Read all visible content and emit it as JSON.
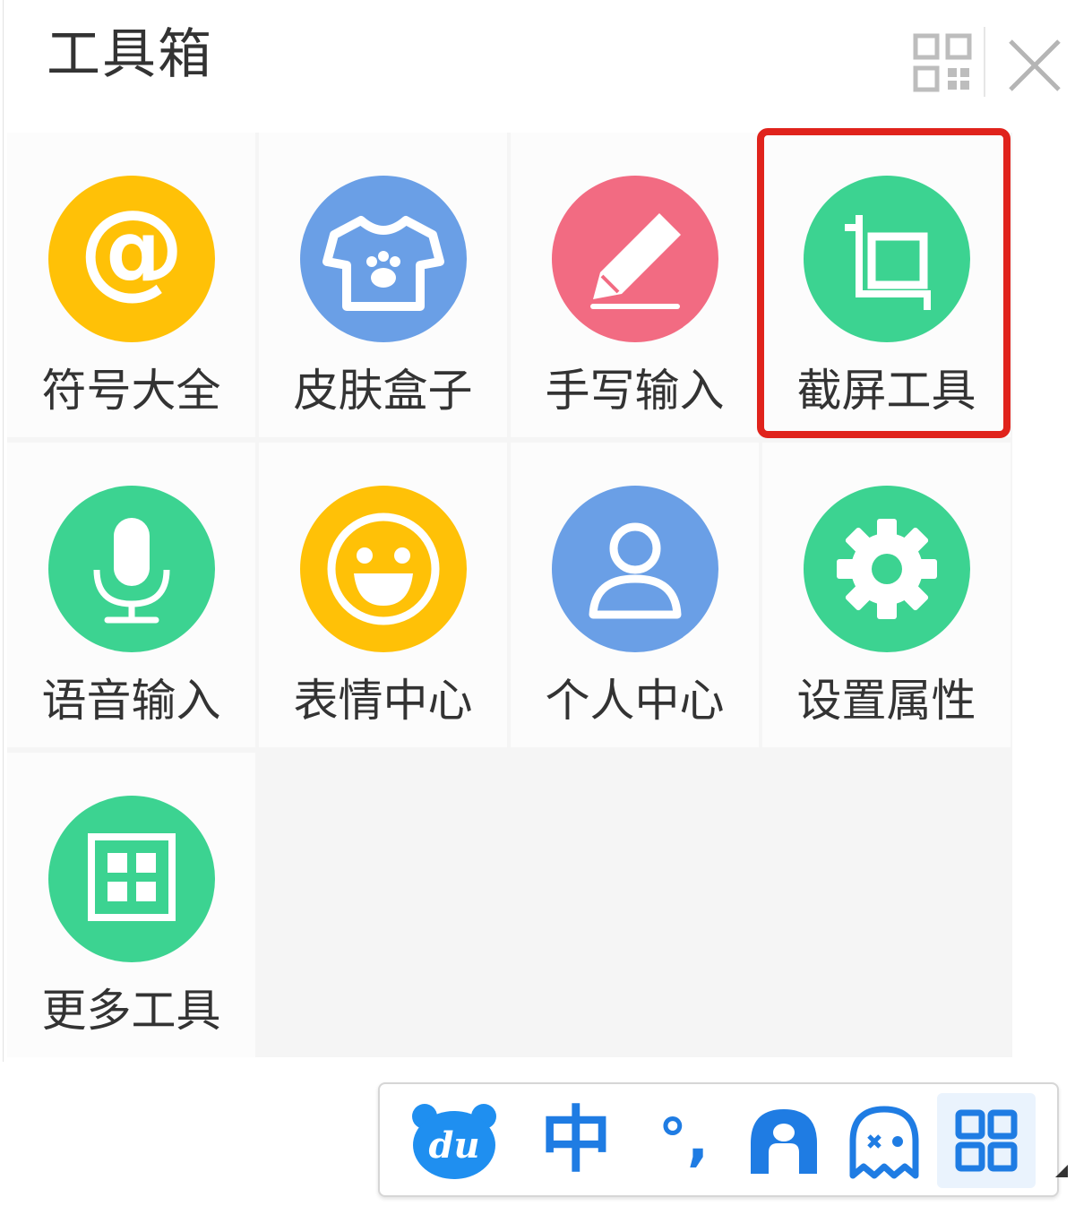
{
  "header": {
    "title": "工具箱",
    "layout_icon": "grid-layout-icon",
    "close_icon": "close-icon"
  },
  "tools": [
    {
      "label": "符号大全",
      "icon": "at-sign-icon",
      "color": "#ffc107"
    },
    {
      "label": "皮肤盒子",
      "icon": "t-shirt-paw-icon",
      "color": "#6a9fe6"
    },
    {
      "label": "手写输入",
      "icon": "pencil-icon",
      "color": "#f26b82"
    },
    {
      "label": "截屏工具",
      "icon": "crop-icon",
      "color": "#3cd391",
      "highlighted": true
    },
    {
      "label": "语音输入",
      "icon": "microphone-icon",
      "color": "#3cd391"
    },
    {
      "label": "表情中心",
      "icon": "smiley-face-icon",
      "color": "#ffc107"
    },
    {
      "label": "个人中心",
      "icon": "user-icon",
      "color": "#6a9fe6"
    },
    {
      "label": "设置属性",
      "icon": "gear-icon",
      "color": "#3cd391"
    },
    {
      "label": "更多工具",
      "icon": "more-grid-icon",
      "color": "#3cd391"
    }
  ],
  "ime_bar": {
    "logo_icon": "baidu-du-logo-icon",
    "logo_text": "du",
    "lang_label": "中",
    "punct_label": "°,",
    "items": [
      "skin-icon",
      "emoji-ghost-icon",
      "toolbox-grid-icon"
    ]
  },
  "colors": {
    "accent_blue": "#1f7ce3",
    "highlight_red": "#e0231c"
  }
}
